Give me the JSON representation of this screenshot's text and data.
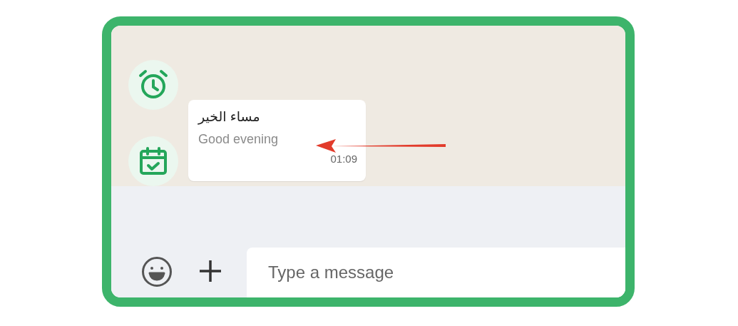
{
  "message": {
    "text": "مساء الخير",
    "translation": "Good evening",
    "time": "01:09"
  },
  "composer": {
    "placeholder": "Type a message"
  }
}
